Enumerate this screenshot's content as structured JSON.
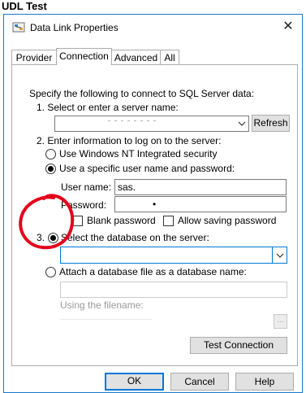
{
  "page_title": "UDL Test",
  "dialog": {
    "title": "Data Link Properties",
    "close_glyph": "✕",
    "icons": [
      "app-icon",
      "close-icon"
    ]
  },
  "tabs": [
    {
      "label": "Provider",
      "active": false
    },
    {
      "label": "Connection",
      "active": true
    },
    {
      "label": "Advanced",
      "active": false
    },
    {
      "label": "All",
      "active": false
    }
  ],
  "connection": {
    "intro": "Specify the following to connect to SQL Server data:",
    "step1_label": "1. Select or enter a server name:",
    "server_value": "",
    "refresh_label": "Refresh",
    "step2_label": "2. Enter information to log on to the server:",
    "radio_nt": "Use Windows NT Integrated security",
    "radio_specific": "Use a specific user name and password:",
    "auth_selected": "specific",
    "username_label": "User name:",
    "username_value": "sas.",
    "password_label": "Password:",
    "password_value": "•",
    "blank_password_label": "Blank password",
    "allow_saving_label": "Allow saving password",
    "step3_label": "3.",
    "select_db_label": "Select the database on the server:",
    "database_value": "",
    "attach_label": "Attach a database file as a database name:",
    "attach_value": "",
    "using_filename_label": "Using the filename:",
    "browse_label": "...",
    "test_connection_label": "Test Connection"
  },
  "footer": {
    "ok_label": "OK",
    "cancel_label": "Cancel",
    "help_label": "Help"
  },
  "colors": {
    "accent": "#0078d7",
    "annotation": "#e4001b",
    "dialog_border": "#1979ca"
  }
}
